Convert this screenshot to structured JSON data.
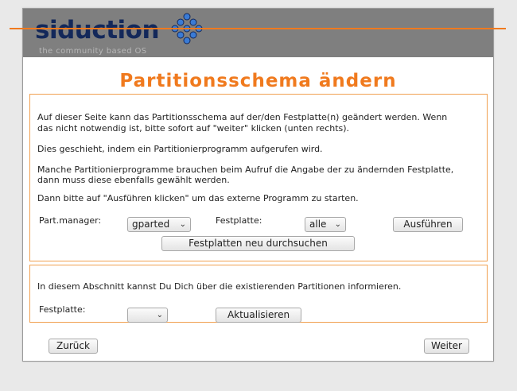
{
  "brand": {
    "logo_text": "siduction",
    "tagline": "the community based OS",
    "accent_color": "#f07a1e",
    "navy_color": "#13285a"
  },
  "page": {
    "title": "Partitionsschema ändern"
  },
  "section1": {
    "paragraph1_line1": "Auf dieser Seite kann das Partitionsschema auf der/den Festplatte(n) geändert werden. Wenn",
    "paragraph1_line2": "das nicht notwendig ist, bitte sofort auf \"weiter\" klicken (unten rechts).",
    "paragraph2": "Dies geschieht, indem ein Partitionierprogramm aufgerufen wird.",
    "paragraph3_line1": "Manche Partitionierprogramme brauchen beim Aufruf die Angabe der zu ändernden Festplatte,",
    "paragraph3_line2": "dann muss diese ebenfalls gewählt werden.",
    "paragraph4": "Dann bitte auf \"Ausführen klicken\" um das externe Programm zu starten.",
    "part_manager_label": "Part.manager:",
    "part_manager_value": "gparted",
    "disk_label": "Festplatte:",
    "disk_value": "alle",
    "execute_button": "Ausführen",
    "rescan_button": "Festplatten neu durchsuchen"
  },
  "section2": {
    "info_text": "In diesem Abschnitt kannst Du Dich über die existierenden Partitionen informieren.",
    "disk_label": "Festplatte:",
    "disk_value": "",
    "refresh_button": "Aktualisieren"
  },
  "nav": {
    "back_button": "Zurück",
    "next_button": "Weiter"
  }
}
